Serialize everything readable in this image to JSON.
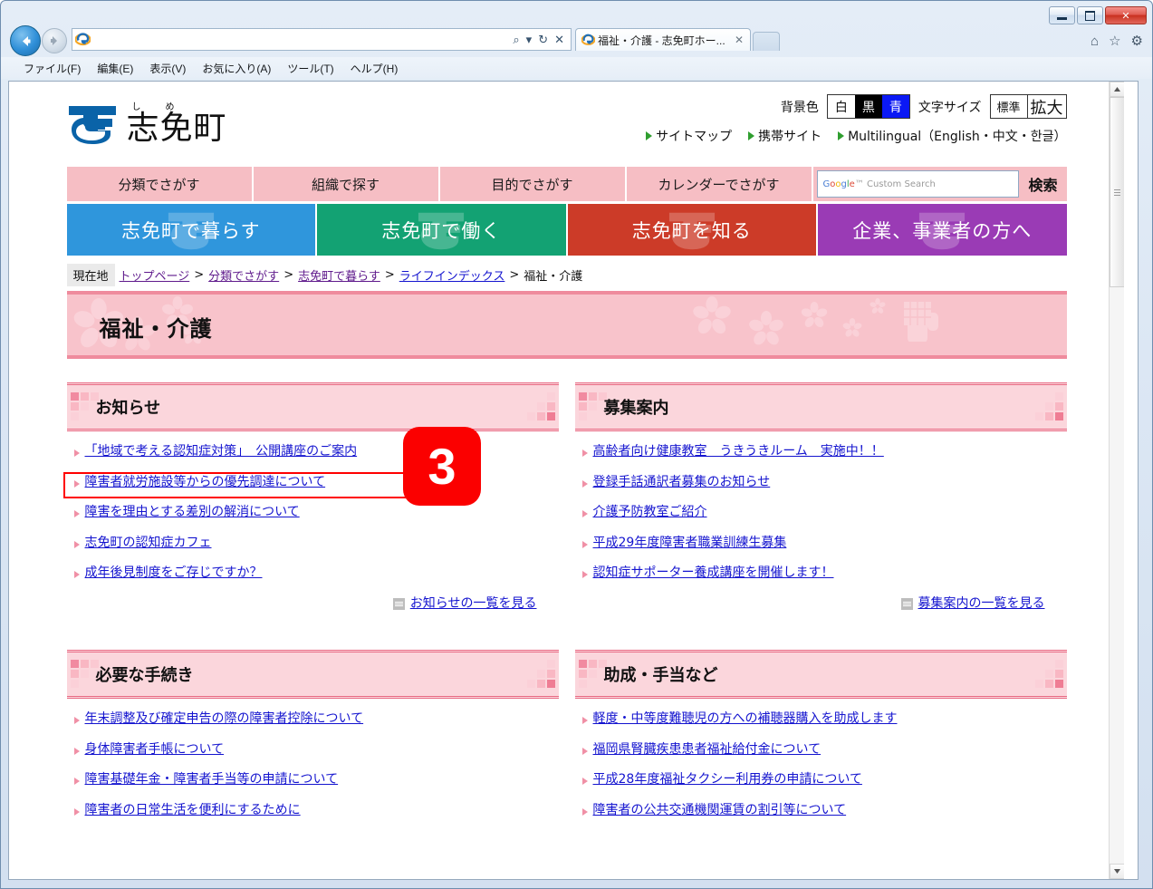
{
  "browser": {
    "address_value": "",
    "address_placeholder": "",
    "tab_title": "福祉・介護 - 志免町ホー...",
    "tab_close": "✕",
    "newtab_label": "",
    "menu": [
      "ファイル(F)",
      "編集(E)",
      "表示(V)",
      "お気に入り(A)",
      "ツール(T)",
      "ヘルプ(H)"
    ],
    "addr_tools": {
      "search": "⌕",
      "dropdown": "▾",
      "refresh": "↻",
      "stop": "✕"
    },
    "chrome_icons": {
      "home": "⌂",
      "favorites": "☆",
      "tools": "⚙"
    },
    "window_buttons": {
      "minimize": "",
      "maximize": "",
      "close": "✕"
    }
  },
  "site": {
    "logo": {
      "ruby1": "し",
      "ruby2": "め",
      "name": "志免町"
    },
    "bgcolor_label": "背景色",
    "bgcolor_options": [
      "白",
      "黒",
      "青"
    ],
    "textsize_label": "文字サイズ",
    "textsize_options": [
      "標準",
      "拡大"
    ],
    "utility_links": [
      "サイトマップ",
      "携帯サイト",
      "Multilingual（English・中文・한글）"
    ]
  },
  "find_nav": {
    "tabs": [
      "分類でさがす",
      "組織で探す",
      "目的でさがす",
      "カレンダーでさがす"
    ],
    "search_placeholder": "Custom Search",
    "search_brand": "Google",
    "search_tm": "™",
    "search_value": "",
    "search_button": "検索"
  },
  "banners": [
    {
      "label": "志免町で暮らす",
      "color": "#2f96dc"
    },
    {
      "label": "志免町で働く",
      "color": "#13a273"
    },
    {
      "label": "志免町を知る",
      "color": "#cc3b28"
    },
    {
      "label": "企業、事業者の方へ",
      "color": "#9a3bb5"
    }
  ],
  "breadcrumb": {
    "badge": "現在地",
    "items": [
      {
        "label": "トップページ",
        "link": true,
        "visited": true
      },
      {
        "label": "分類でさがす",
        "link": true,
        "visited": true
      },
      {
        "label": "志免町で暮らす",
        "link": true,
        "visited": true
      },
      {
        "label": "ライフインデックス",
        "link": true,
        "visited": false
      },
      {
        "label": "福祉・介護",
        "link": false,
        "visited": false
      }
    ],
    "separator": ">"
  },
  "page_title": "福祉・介護",
  "panels": [
    {
      "heading": "お知らせ",
      "links": [
        "「地域で考える認知症対策」　公開講座のご案内",
        "障害者就労施設等からの優先調達について",
        "障害を理由とする差別の解消について",
        "志免町の認知症カフェ",
        "成年後見制度をご存じですか？"
      ],
      "more": "お知らせの一覧を見る"
    },
    {
      "heading": "募集案内",
      "links": [
        "高齢者向け健康教室　うきうきルーム　実施中！！",
        "登録手話通訳者募集のお知らせ",
        "介護予防教室ご紹介",
        "平成29年度障害者職業訓練生募集",
        "認知症サポーター養成講座を開催します！"
      ],
      "more": "募集案内の一覧を見る"
    },
    {
      "heading": "必要な手続き",
      "links": [
        "年末調整及び確定申告の際の障害者控除について",
        "身体障害者手帳について",
        "障害基礎年金・障害者手当等の申請について",
        "障害者の日常生活を便利にするために"
      ],
      "more": ""
    },
    {
      "heading": "助成・手当など",
      "links": [
        "軽度・中等度難聴児の方への補聴器購入を助成します",
        "福岡県腎臓疾患患者福祉給付金について",
        "平成28年度福祉タクシー利用券の申請について",
        "障害者の公共交通機関運賃の割引等について"
      ],
      "more": ""
    }
  ],
  "annotation": {
    "step_number": "3",
    "highlight_target": "障害者就労施設等からの優先調達について",
    "accent_color": "#fb0000"
  }
}
